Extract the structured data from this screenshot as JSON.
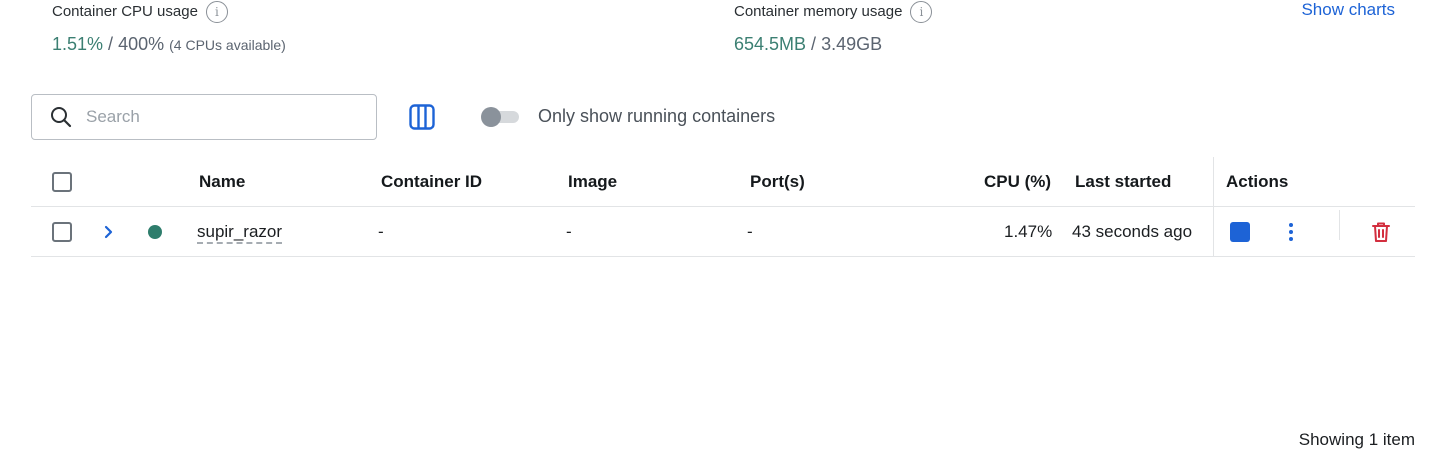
{
  "stats": {
    "cpu": {
      "label": "Container CPU usage",
      "used": "1.51%",
      "separator": " / ",
      "total": "400%",
      "note": "(4 CPUs available)"
    },
    "memory": {
      "label": "Container memory usage",
      "used": "654.5MB",
      "separator": " / ",
      "total": "3.49GB"
    },
    "info_icon_glyph": "i",
    "show_charts_label": "Show charts"
  },
  "toolbar": {
    "search_placeholder": "Search",
    "toggle_label": "Only show running containers",
    "toggle_on": false
  },
  "table": {
    "columns": {
      "name": "Name",
      "container_id": "Container ID",
      "image": "Image",
      "ports": "Port(s)",
      "cpu": "CPU (%)",
      "last_started": "Last started",
      "actions": "Actions"
    },
    "rows": [
      {
        "name": "supir_razor",
        "container_id": "-",
        "image": "-",
        "ports": "-",
        "cpu": "1.47%",
        "last_started": "43 seconds ago",
        "status": "running"
      }
    ]
  },
  "footer": {
    "showing": "Showing 1 item"
  },
  "icons": [
    "info-icon",
    "search-icon",
    "columns-icon",
    "chevron-right-icon",
    "status-dot-icon",
    "stop-icon",
    "kebab-menu-icon",
    "trash-icon"
  ],
  "colors": {
    "accent_blue": "#1d63d6",
    "running_green": "#2e7d6c",
    "stat_green": "#3b7f72",
    "delete_red": "#d32f3f"
  }
}
